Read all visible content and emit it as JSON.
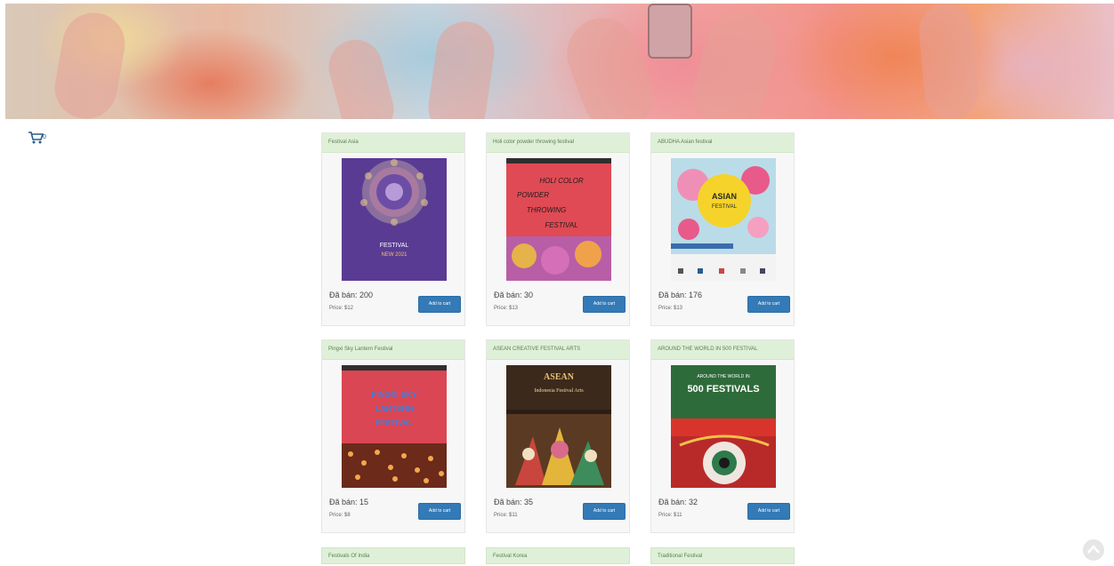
{
  "cart": {
    "icon": "shopping-cart-icon",
    "count": "0"
  },
  "products": [
    {
      "title": "Festival Asia",
      "stock_label": "Đã bán: 200",
      "price_label": "Price: $12",
      "button": "Add to cart"
    },
    {
      "title": "Holi color powder throwing festival",
      "stock_label": "Đã bán: 30",
      "price_label": "Price: $13",
      "button": "Add to cart"
    },
    {
      "title": "ABUDHA Asian festival",
      "stock_label": "Đã bán: 176",
      "price_label": "Price: $13",
      "button": "Add to cart"
    },
    {
      "title": "Pingxi Sky Lantern Festival",
      "stock_label": "Đã bán: 15",
      "price_label": "Price: $8",
      "button": "Add to cart"
    },
    {
      "title": "ASEAN CREATIVE FESTIVAL ARTS",
      "stock_label": "Đã bán: 35",
      "price_label": "Price: $11",
      "button": "Add to cart"
    },
    {
      "title": "AROUND THE WORLD IN 500 FESTIVAL",
      "stock_label": "Đã bán: 32",
      "price_label": "Price: $11",
      "button": "Add to cart"
    }
  ],
  "next_row": [
    {
      "title": "Festivals Of India"
    },
    {
      "title": "Festival Korea"
    },
    {
      "title": "Traditional Festival"
    }
  ],
  "posters": {
    "p1": {
      "text1": "FESTIVAL",
      "text2": "NEW 2021"
    },
    "p2": {
      "text1": "HOLI COLOR",
      "text2": "POWDER",
      "text3": "THROWING",
      "text4": "FESTIVAL"
    },
    "p3": {
      "text1": "ASIAN",
      "text2": "FESTIVAL"
    },
    "p4": {
      "text1": "PINGXI SKY",
      "text2": "LANTERN",
      "text3": "FESTIVAL"
    },
    "p5": {
      "text1": "ASEAN",
      "text2": "Indonesia Festival Arts"
    },
    "p6": {
      "text1": "AROUND THE WORLD IN",
      "text2": "500 FESTIVALS"
    }
  },
  "colors": {
    "accent": "#337ab7",
    "header_bg": "#dff0d8"
  }
}
